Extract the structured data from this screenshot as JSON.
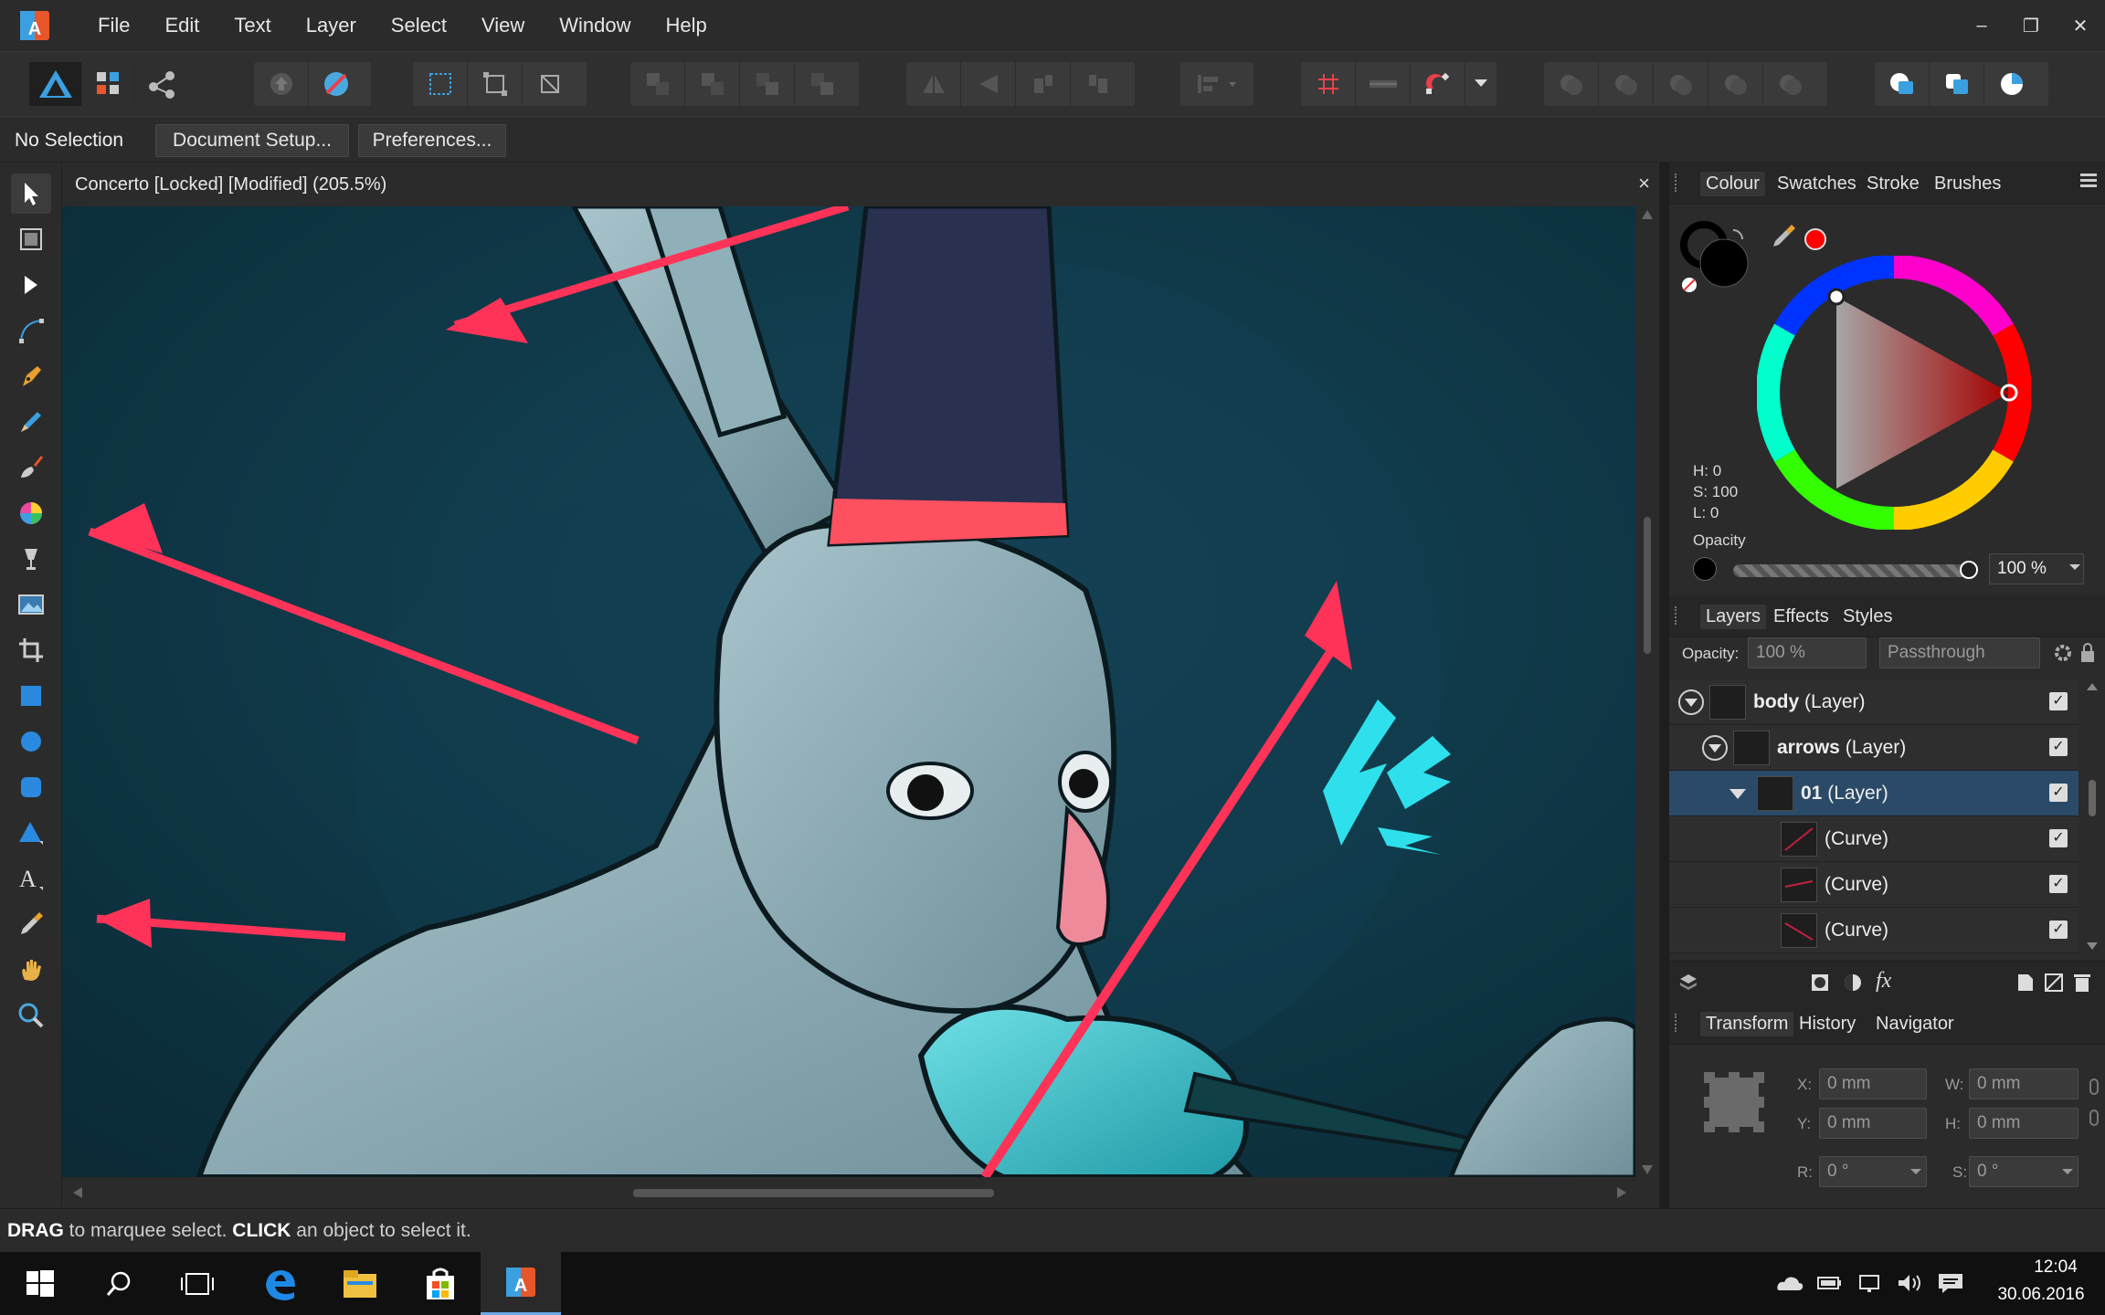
{
  "app": {
    "accent": "#3aa0e0",
    "icon": "affinity-designer-icon"
  },
  "menu": {
    "items": [
      "File",
      "Edit",
      "Text",
      "Layer",
      "Select",
      "View",
      "Window",
      "Help"
    ]
  },
  "window_controls": {
    "minimize": "–",
    "restore": "❐",
    "close": "✕"
  },
  "context_bar": {
    "selection": "No Selection",
    "document_setup": "Document Setup...",
    "preferences": "Preferences..."
  },
  "document": {
    "title": "Concerto [Locked] [Modified] (205.5%)",
    "close": "×"
  },
  "colour_panel": {
    "tabs": [
      "Colour",
      "Swatches",
      "Stroke",
      "Brushes"
    ],
    "hsl": {
      "h": "H: 0",
      "s": "S: 100",
      "l": "L: 0"
    },
    "opacity_label": "Opacity",
    "opacity_value": "100 %",
    "primary_color": "#000000",
    "picked_color": "#ff0000",
    "opacity_fraction": 1.0
  },
  "layers_panel": {
    "tabs": [
      "Layers",
      "Effects",
      "Styles"
    ],
    "opacity_label": "Opacity:",
    "opacity_value": "100 %",
    "blend_mode": "Passthrough",
    "rows": [
      {
        "name": "body",
        "kind": "(Layer)"
      },
      {
        "name": "arrows",
        "kind": "(Layer)"
      },
      {
        "name": "01",
        "kind": "(Layer)"
      },
      {
        "name": "",
        "kind": "(Curve)"
      },
      {
        "name": "",
        "kind": "(Curve)"
      },
      {
        "name": "",
        "kind": "(Curve)"
      }
    ]
  },
  "transform_panel": {
    "tabs": [
      "Transform",
      "History",
      "Navigator"
    ],
    "x_label": "X:",
    "x_value": "0 mm",
    "y_label": "Y:",
    "y_value": "0 mm",
    "w_label": "W:",
    "w_value": "0 mm",
    "h_label": "H:",
    "h_value": "0 mm",
    "r_label": "R:",
    "r_value": "0 °",
    "s_label": "S:",
    "s_value": "0 °"
  },
  "status": {
    "drag": "DRAG",
    "drag_text": " to marquee select. ",
    "click": "CLICK",
    "click_text": " an object to select it."
  },
  "taskbar": {
    "time": "12:04",
    "date": "30.06.2016"
  }
}
